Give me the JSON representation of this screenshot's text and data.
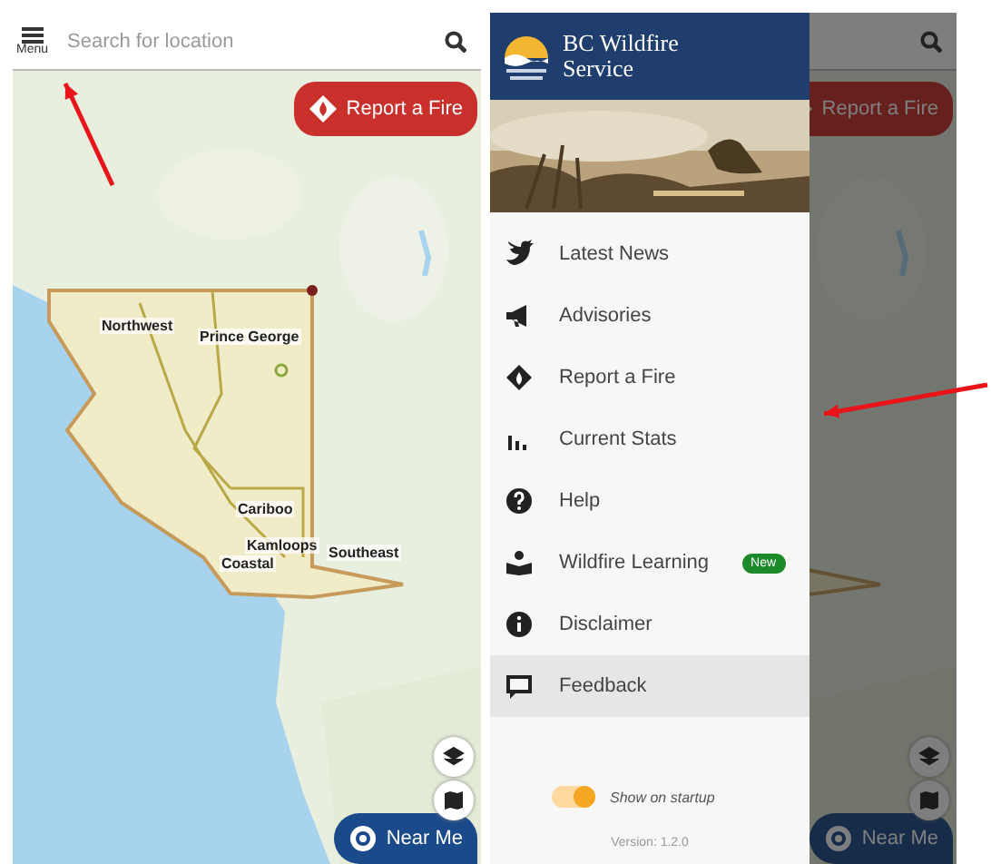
{
  "left_screen": {
    "menu_button": {
      "label": "Menu"
    },
    "search": {
      "placeholder": "Search for location"
    },
    "report_button": {
      "label": "Report a Fire"
    },
    "map_labels": [
      "Northwest",
      "Prince George",
      "Cariboo",
      "Kamloops",
      "Coastal",
      "Southeast"
    ],
    "near_me_button": {
      "label": "Near Me"
    }
  },
  "right_screen": {
    "drawer": {
      "title_lines": [
        "BC Wildfire",
        "Service"
      ],
      "items": [
        {
          "label": "Latest News",
          "selected": false
        },
        {
          "label": "Advisories",
          "selected": false
        },
        {
          "label": "Report a Fire",
          "selected": false
        },
        {
          "label": "Current Stats",
          "selected": false
        },
        {
          "label": "Help",
          "selected": false
        },
        {
          "label": "Wildfire Learning",
          "selected": false,
          "badge": "New"
        },
        {
          "label": "Disclaimer",
          "selected": false
        },
        {
          "label": "Feedback",
          "selected": true
        }
      ],
      "startup_toggle": {
        "label": "Show on startup",
        "on": true
      },
      "version": "Version: 1.2.0"
    },
    "report_button": {
      "label": "Report a Fire"
    },
    "near_me_button": {
      "label": "Near Me"
    }
  }
}
